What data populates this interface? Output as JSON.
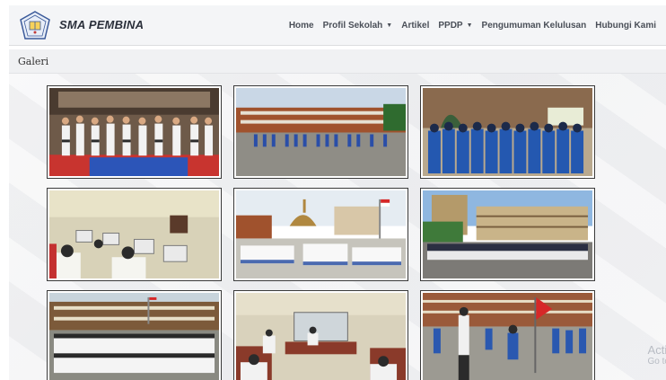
{
  "header": {
    "brand": "SMA PEMBINA",
    "logo_icon": "school-emblem-icon",
    "nav": [
      {
        "label": "Home",
        "dropdown": false
      },
      {
        "label": "Profil Sekolah",
        "dropdown": true
      },
      {
        "label": "Artikel",
        "dropdown": false
      },
      {
        "label": "PPDP",
        "dropdown": true
      },
      {
        "label": "Pengumuman Kelulusan",
        "dropdown": false
      },
      {
        "label": "Hubungi Kami",
        "dropdown": false
      }
    ]
  },
  "breadcrumb": {
    "label": "Galeri"
  },
  "gallery": {
    "photos": [
      {
        "subject": "martial-arts-students"
      },
      {
        "subject": "flag-ceremony-courtyard"
      },
      {
        "subject": "students-group-outdoor"
      },
      {
        "subject": "computer-lab"
      },
      {
        "subject": "mass-assembly-field"
      },
      {
        "subject": "school-building-assembly"
      },
      {
        "subject": "students-group-white"
      },
      {
        "subject": "classroom-event"
      },
      {
        "subject": "flag-raising"
      }
    ]
  },
  "watermark": {
    "line1": "Acti",
    "line2": "Go to"
  },
  "colors": {
    "navbar": "#f4f5f7",
    "brand_text": "#2a2f3a",
    "nav_text": "#4a4f58"
  }
}
